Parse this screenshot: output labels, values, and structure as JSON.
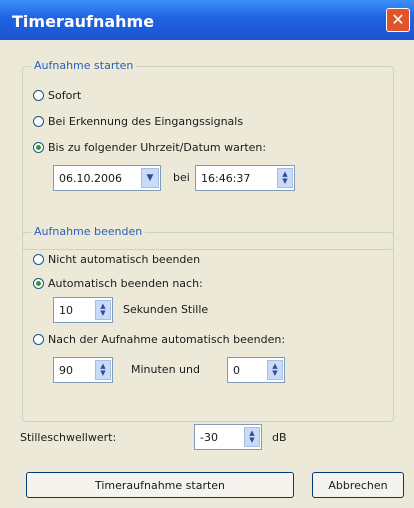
{
  "window": {
    "title": "Timeraufnahme",
    "close_glyph": "✕"
  },
  "start_group": {
    "legend": "Aufnahme starten",
    "options": [
      "Sofort",
      "Bei Erkennung des Eingangssignals",
      "Bis zu folgender Uhrzeit/Datum warten:"
    ],
    "date_value": "06.10.2006",
    "at_label": "bei",
    "time_value": "16:46:37"
  },
  "end_group": {
    "legend": "Aufnahme beenden",
    "options": [
      "Nicht automatisch beenden",
      "Automatisch beenden nach:",
      "Nach der Aufnahme automatisch beenden:"
    ],
    "silence_value": "10",
    "silence_label": "Sekunden Stille",
    "minutes_value": "90",
    "minutes_label": "Minuten und",
    "seconds_value": "0"
  },
  "threshold": {
    "label": "Stilleschwellwert:",
    "value": "-30",
    "unit": "dB"
  },
  "buttons": {
    "start": "Timeraufnahme starten",
    "cancel": "Abbrechen"
  },
  "icons": {
    "spin_up": "▲",
    "spin_down": "▼",
    "dropdown": "▼"
  }
}
